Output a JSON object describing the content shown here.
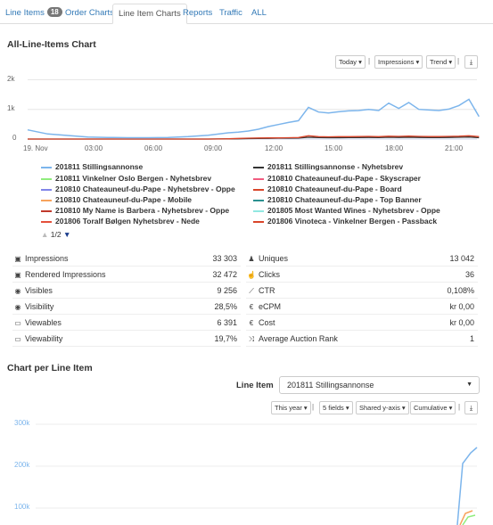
{
  "tabs": [
    {
      "label": "Line Items",
      "badge": "18"
    },
    {
      "label": "Order Charts"
    },
    {
      "label": "Line Item Charts"
    },
    {
      "label": "Reports"
    },
    {
      "label": "Traffic"
    },
    {
      "label": "ALL"
    }
  ],
  "chart_section": {
    "title": "All-Line-Items Chart",
    "controls": {
      "period": "Today ▾",
      "metric": "Impressions ▾",
      "mode": "Trend ▾"
    }
  },
  "chart_data": {
    "type": "line",
    "title": "",
    "xlabel": "",
    "ylabel": "",
    "x_ticks": [
      "19. Nov",
      "03:00",
      "06:00",
      "09:00",
      "12:00",
      "15:00",
      "18:00",
      "21:00"
    ],
    "y_ticks": [
      "0",
      "1k",
      "2k"
    ],
    "ylim": [
      0,
      2000
    ],
    "x_hours": [
      0,
      1,
      2,
      3,
      4,
      5,
      6,
      7,
      8,
      9,
      10,
      10.5,
      11,
      11.5,
      12,
      12.5,
      13,
      13.5,
      14,
      14.5,
      15,
      15.5,
      16,
      16.5,
      17,
      17.5,
      18,
      18.5,
      19,
      19.5,
      20,
      20.5,
      21,
      21.5,
      22,
      22.5
    ],
    "series": [
      {
        "name": "201811 Stillingsannonse",
        "color": "#7cb5ec",
        "values": [
          310,
          170,
          120,
          70,
          55,
          45,
          45,
          50,
          80,
          130,
          210,
          230,
          270,
          330,
          420,
          490,
          560,
          620,
          1070,
          910,
          880,
          920,
          950,
          960,
          1000,
          960,
          1210,
          1030,
          1230,
          1000,
          980,
          960,
          1010,
          1130,
          1340,
          760
        ]
      },
      {
        "name": "201806 Vinoteca - Vinkelner Bergen - Passback",
        "color": "#d9452a",
        "values": [
          0,
          0,
          0,
          0,
          0,
          0,
          0,
          0,
          0,
          0,
          10,
          20,
          30,
          35,
          40,
          40,
          45,
          50,
          110,
          80,
          75,
          80,
          80,
          85,
          90,
          80,
          95,
          90,
          100,
          90,
          85,
          85,
          90,
          95,
          110,
          80
        ]
      },
      {
        "name": "201811 Stillingsannonse - Nyhetsbrev",
        "color": "#333333",
        "values": [
          0,
          0,
          0,
          0,
          0,
          0,
          0,
          0,
          0,
          0,
          5,
          10,
          15,
          20,
          25,
          30,
          30,
          35,
          60,
          50,
          45,
          45,
          50,
          50,
          55,
          50,
          60,
          55,
          60,
          55,
          50,
          50,
          55,
          60,
          70,
          45
        ]
      }
    ]
  },
  "legend": [
    {
      "label": "201811 Stillingsannonse",
      "color": "#7cb5ec"
    },
    {
      "label": "210811 Vinkelner Oslo Bergen - Nyhetsbrev",
      "color": "#90ed7d"
    },
    {
      "label": "210810 Chateauneuf-du-Pape - Nyhetsbrev - Oppe",
      "color": "#8085e9"
    },
    {
      "label": "210810 Chateauneuf-du-Pape - Mobile",
      "color": "#f7a35c"
    },
    {
      "label": "210810 My Name is Barbera - Nyhetsbrev - Oppe",
      "color": "#c0392b"
    },
    {
      "label": "201806 Toralf Bølgen Nyhetsbrev - Nede",
      "color": "#e4503b"
    },
    {
      "label": "201811 Stillingsannonse - Nyhetsbrev",
      "color": "#333333"
    },
    {
      "label": "210810 Chateauneuf-du-Pape - Skyscraper",
      "color": "#f15c80"
    },
    {
      "label": "210810 Chateauneuf-du-Pape - Board",
      "color": "#d9452a"
    },
    {
      "label": "210810 Chateauneuf-du-Pape - Top Banner",
      "color": "#2b908f"
    },
    {
      "label": "201805 Most Wanted Wines - Nyhetsbrev - Oppe",
      "color": "#91e8e1"
    },
    {
      "label": "201806 Vinoteca - Vinkelner Bergen - Passback",
      "color": "#d9452a"
    }
  ],
  "pager": {
    "text": "1/2"
  },
  "stats_left": [
    {
      "icon": "▣",
      "label": "Impressions",
      "value": "33 303"
    },
    {
      "icon": "▣",
      "label": "Rendered Impressions",
      "value": "32 472"
    },
    {
      "icon": "◉",
      "label": "Visibles",
      "value": "9 256"
    },
    {
      "icon": "◉",
      "label": "Visibility",
      "value": "28,5%"
    },
    {
      "icon": "▭",
      "label": "Viewables",
      "value": "6 391"
    },
    {
      "icon": "▭",
      "label": "Viewability",
      "value": "19,7%"
    }
  ],
  "stats_right": [
    {
      "icon": "♟",
      "label": "Uniques",
      "value": "13 042"
    },
    {
      "icon": "☝",
      "label": "Clicks",
      "value": "36"
    },
    {
      "icon": "⟋",
      "label": "CTR",
      "value": "0,108%"
    },
    {
      "icon": "€",
      "label": "eCPM",
      "value": "kr 0,00"
    },
    {
      "icon": "€",
      "label": "Cost",
      "value": "kr 0,00"
    },
    {
      "icon": "⤨",
      "label": "Average Auction Rank",
      "value": "1"
    }
  ],
  "per_item": {
    "title": "Chart per Line Item",
    "select_label": "Line Item",
    "select_value": "201811 Stillingsannonse",
    "controls": {
      "period": "This year ▾",
      "fields": "5 fields ▾",
      "axis": "Shared y-axis ▾",
      "mode": "Cumulative ▾"
    }
  },
  "chart_data_2": {
    "type": "line",
    "y_ticks": [
      "300k",
      "200k",
      "100k"
    ],
    "ylim": [
      0,
      300000
    ]
  }
}
